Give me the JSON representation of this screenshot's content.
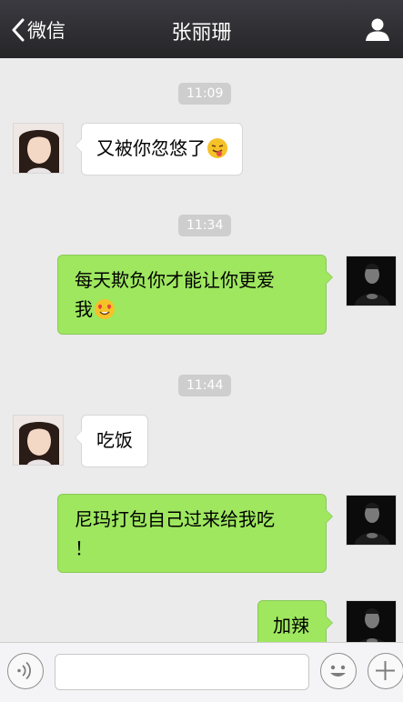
{
  "header": {
    "back_label": "微信",
    "title": "张丽珊"
  },
  "messages": [
    {
      "time": "11:09"
    },
    {
      "text": "又被你忽悠了",
      "emoji": "face-with-tongue-emoji"
    },
    {
      "time": "11:34"
    },
    {
      "line1": "每天欺负你才能让你更爱",
      "line2": "我",
      "emoji": "heart-eyes-emoji"
    },
    {
      "time": "11:44"
    },
    {
      "text": "吃饭"
    },
    {
      "line1": "尼玛打包自己过来给我吃",
      "line2": "！"
    },
    {
      "text": "加辣"
    }
  ],
  "input": {
    "value": "",
    "placeholder": ""
  },
  "colors": {
    "header_bg": "#2e2e33",
    "chat_bg": "#ebebeb",
    "sent_bubble": "#9ee75f",
    "received_bubble": "#ffffff",
    "timestamp_bg": "#cecece"
  }
}
